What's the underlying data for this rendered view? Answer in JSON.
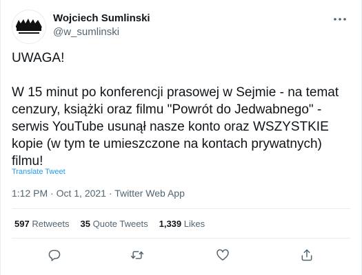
{
  "user": {
    "display_name": "Wojciech Sumlinski",
    "handle": "@w_sumlinski"
  },
  "tweet": {
    "text": "UWAGA!\n\nW 15 minut po konferencji prasowej w Sejmie - na temat cenzury, książki oraz filmu \"Powrót do Jedwabnego\" - serwis YouTube usunął nasze konto oraz WSZYSTKIE kopie (w tym te umieszczone na kontach prywatnych) filmu!",
    "translate_label": "Translate Tweet",
    "time": "1:12 PM",
    "sep1": " · ",
    "date": "Oct 1, 2021",
    "sep2": " · ",
    "source": "Twitter Web App"
  },
  "stats": {
    "retweets_count": "597",
    "retweets_label": "Retweets",
    "quotes_count": "35",
    "quotes_label": "Quote Tweets",
    "likes_count": "1,339",
    "likes_label": "Likes"
  },
  "icons": {
    "more": "more-dots-icon",
    "reply": "reply-icon",
    "retweet": "retweet-icon",
    "like": "heart-icon",
    "share": "share-icon"
  },
  "colors": {
    "accent": "#1d9bf0",
    "text": "#0f1419",
    "muted": "#536471",
    "border": "#e6ecf0"
  }
}
